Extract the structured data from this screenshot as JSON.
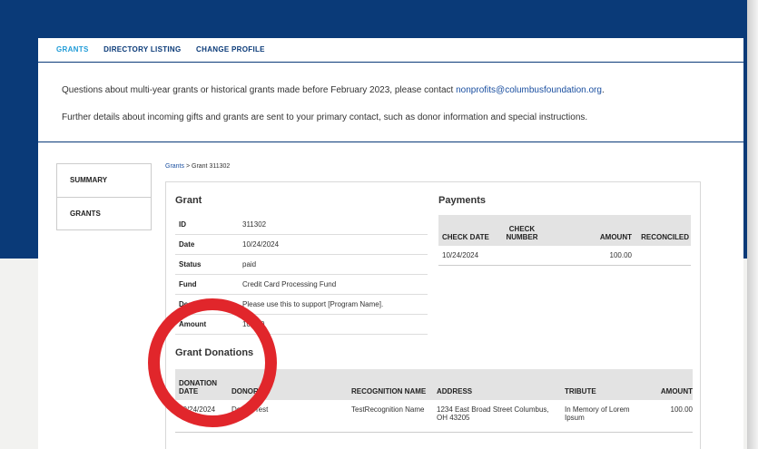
{
  "nav": {
    "tabs": [
      "GRANTS",
      "DIRECTORY LISTING",
      "CHANGE PROFILE"
    ]
  },
  "messages": {
    "line1_prefix": "Questions about multi-year grants or historical grants made before February 2023, please contact ",
    "line1_link": "nonprofits@columbusfoundation.org",
    "line1_suffix": ".",
    "line2": "Further details about incoming gifts and grants are sent to your primary contact, such as donor information and special instructions."
  },
  "sidebar": {
    "items": [
      "SUMMARY",
      "GRANTS"
    ]
  },
  "breadcrumb": {
    "link": "Grants",
    "sep": " > ",
    "current": "Grant 311302"
  },
  "grant": {
    "title": "Grant",
    "rows": [
      {
        "label": "ID",
        "value": "311302"
      },
      {
        "label": "Date",
        "value": "10/24/2024"
      },
      {
        "label": "Status",
        "value": "paid"
      },
      {
        "label": "Fund",
        "value": "Credit Card Processing Fund"
      },
      {
        "label": "Description",
        "value": "Please use this to support [Program Name]."
      },
      {
        "label": "Amount",
        "value": "100.00"
      }
    ]
  },
  "payments": {
    "title": "Payments",
    "headers": [
      "CHECK DATE",
      "CHECK NUMBER",
      "AMOUNT",
      "RECONCILED"
    ],
    "rows": [
      {
        "date": "10/24/2024",
        "number": "",
        "amount": "100.00",
        "reconciled": ""
      }
    ]
  },
  "donations": {
    "title": "Grant Donations",
    "headers": [
      "DONATION DATE",
      "DONOR",
      "RECOGNITION NAME",
      "ADDRESS",
      "TRIBUTE",
      "AMOUNT"
    ],
    "rows": [
      {
        "date": "10/24/2024",
        "donor": "Donor, Test",
        "recognition": "TestRecognition Name",
        "address": "1234 East Broad Street Columbus, OH 43205",
        "tribute": "In Memory of Lorem Ipsum",
        "amount": "100.00"
      }
    ]
  },
  "colors": {
    "brand": "#0a3a78",
    "accent": "#1f9bd7",
    "highlight": "#e1262b"
  }
}
